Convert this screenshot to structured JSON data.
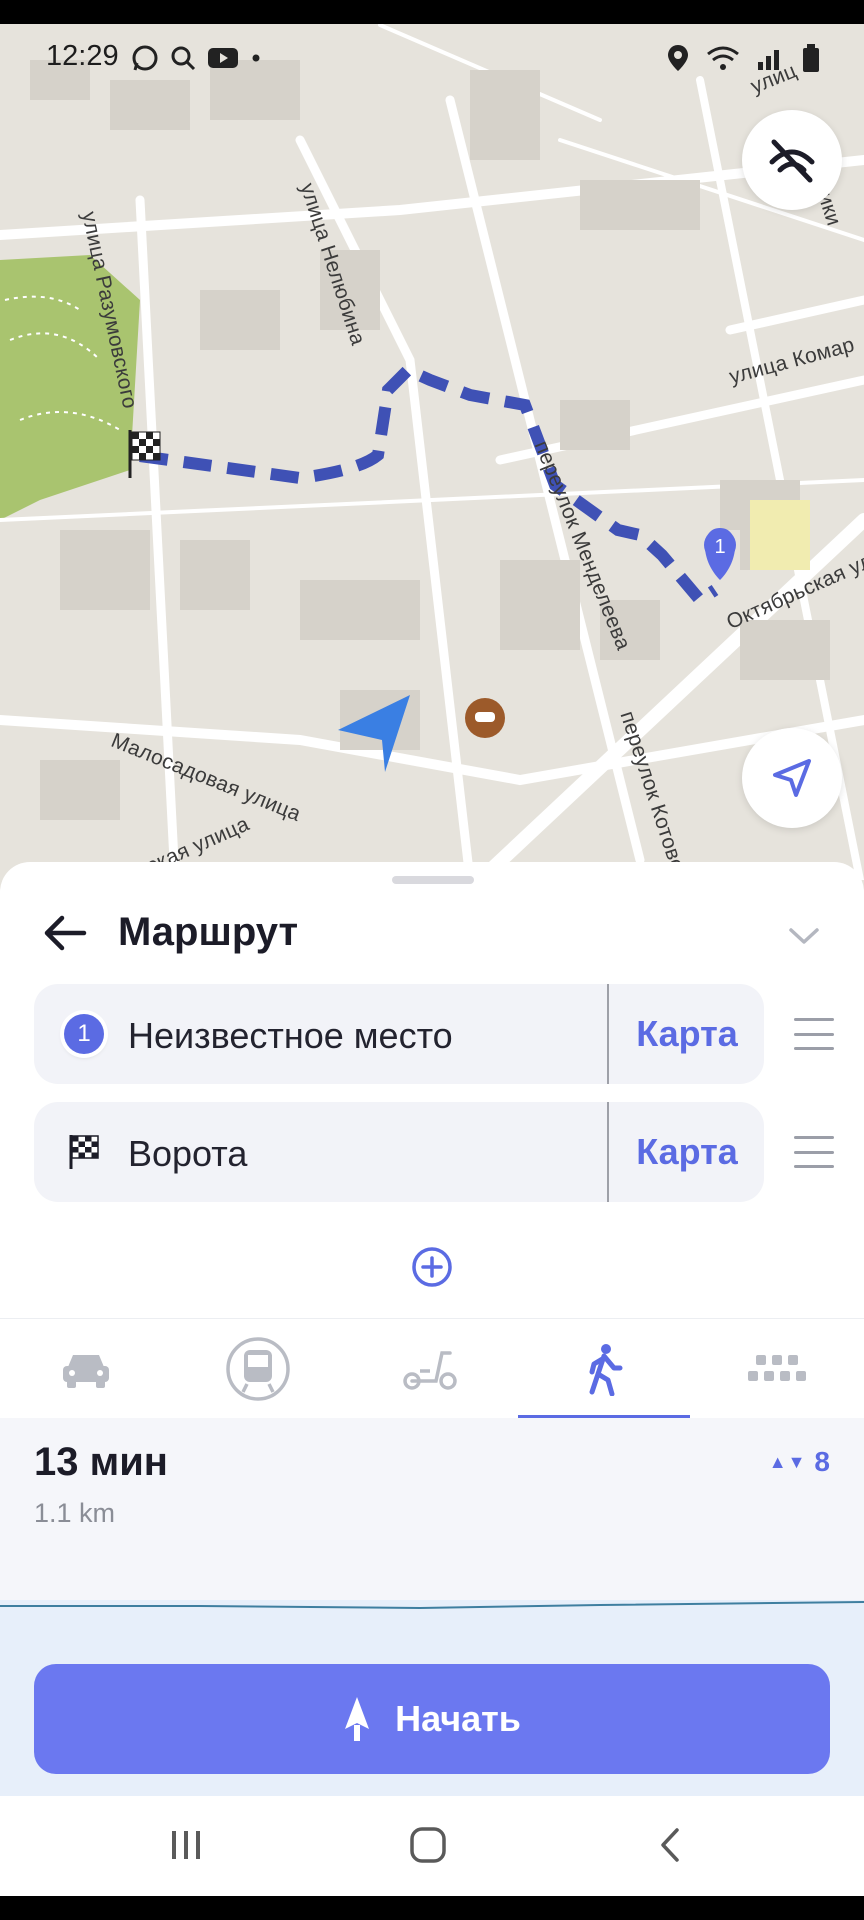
{
  "status_bar": {
    "time": "12:29",
    "left_icons": [
      "whatsapp-icon",
      "search-icon",
      "youtube-icon",
      "dot-icon"
    ],
    "right_icons": [
      "location-icon",
      "wifi-icon",
      "signal-icon",
      "battery-icon"
    ]
  },
  "map": {
    "streets": [
      "улица Разумовского",
      "улица Нелюбина",
      "улица Комар",
      "переулок Менделеева",
      "Октябрьская улица",
      "переулок Котово",
      "Малосадовая улица",
      "ская улица",
      "улиц",
      "ники"
    ],
    "start_marker": "1",
    "buttons": {
      "traffic_toggle": "traffic-off-icon",
      "my_location": "navigation-arrow-icon"
    }
  },
  "sheet": {
    "title": "Маршрут",
    "points": [
      {
        "badge": "1",
        "label": "Неизвестное место",
        "map_button": "Карта"
      },
      {
        "badge": "finish-flag-icon",
        "label": "Ворота",
        "map_button": "Карта"
      }
    ],
    "modes": [
      "car-icon",
      "public-transport-icon",
      "scooter-icon",
      "walk-icon",
      "taxi-icon"
    ],
    "active_mode": "walk-icon",
    "route": {
      "duration": "13 мин",
      "distance": "1.1 km",
      "elevation": "8",
      "elevation_icon": "▲▼"
    },
    "start_button": "Начать"
  },
  "colors": {
    "accent": "#5b6be3",
    "route": "#3f51b5",
    "start_button": "#6b78f0",
    "park": "#a6c26b"
  }
}
